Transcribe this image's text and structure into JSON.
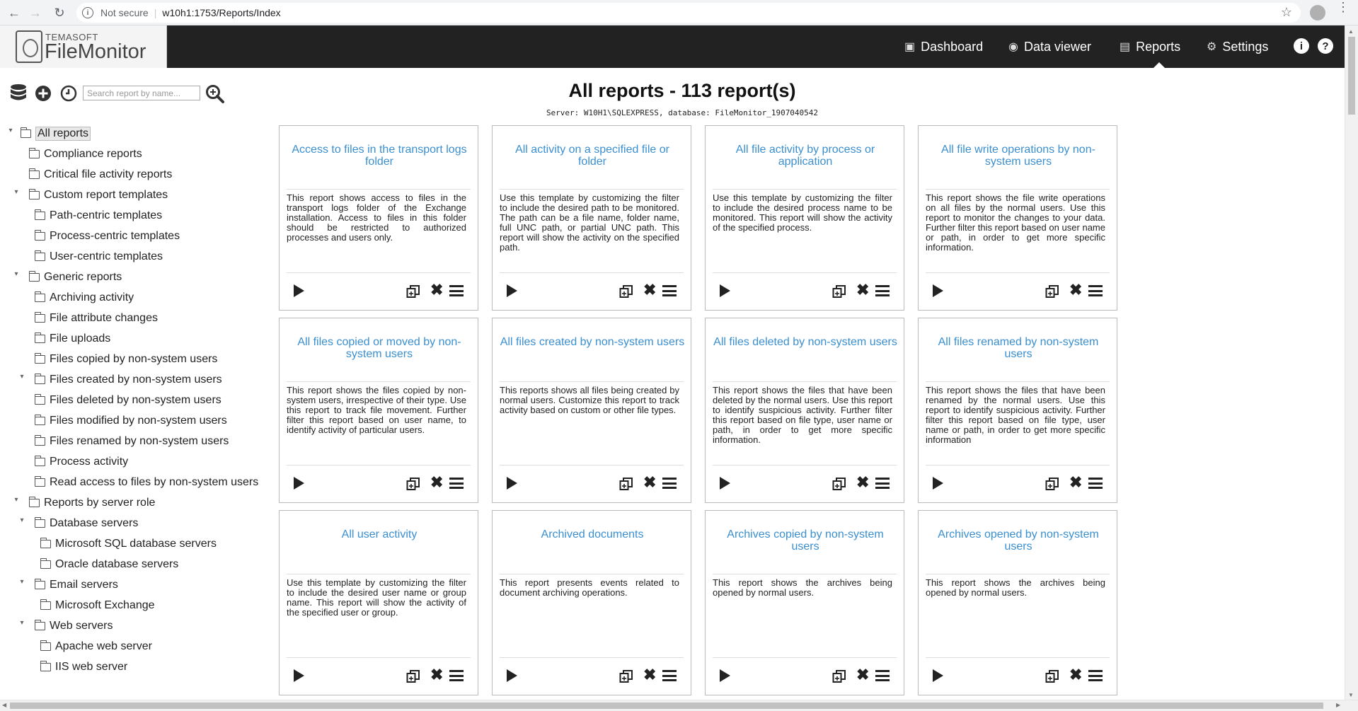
{
  "browser": {
    "security_label": "Not secure",
    "url": "w10h1:1753/Reports/Index"
  },
  "header": {
    "logo_top": "TEMASOFT",
    "logo_bottom": "FileMonitor",
    "nav": [
      {
        "label": "Dashboard",
        "icon": "dashboard-icon"
      },
      {
        "label": "Data viewer",
        "icon": "data-viewer-icon"
      },
      {
        "label": "Reports",
        "icon": "reports-icon",
        "active": true
      },
      {
        "label": "Settings",
        "icon": "gear-icon"
      }
    ],
    "info_glyph": "i",
    "help_glyph": "?"
  },
  "sidebar": {
    "search_placeholder": "Search report by name...",
    "tree": [
      {
        "label": "All reports"
      },
      {
        "label": "Compliance reports"
      },
      {
        "label": "Critical file activity reports"
      },
      {
        "label": "Custom report templates"
      },
      {
        "label": "Path-centric templates"
      },
      {
        "label": "Process-centric templates"
      },
      {
        "label": "User-centric templates"
      },
      {
        "label": "Generic reports"
      },
      {
        "label": "Archiving activity"
      },
      {
        "label": "File attribute changes"
      },
      {
        "label": "File uploads"
      },
      {
        "label": "Files copied by non-system users"
      },
      {
        "label": "Files created by non-system users"
      },
      {
        "label": "Files deleted by non-system users"
      },
      {
        "label": "Files modified by non-system users"
      },
      {
        "label": "Files renamed by non-system users"
      },
      {
        "label": "Process activity"
      },
      {
        "label": "Read access to files by non-system users"
      },
      {
        "label": "Reports by server role"
      },
      {
        "label": "Database servers"
      },
      {
        "label": "Microsoft SQL database servers"
      },
      {
        "label": "Oracle database servers"
      },
      {
        "label": "Email servers"
      },
      {
        "label": "Microsoft Exchange"
      },
      {
        "label": "Web servers"
      },
      {
        "label": "Apache web server"
      },
      {
        "label": "IIS web server"
      }
    ]
  },
  "main": {
    "title": "All reports - 113 report(s)",
    "server_line": "Server: W10H1\\SQLEXPRESS, database: FileMonitor_1907040542",
    "cards": [
      {
        "title": "Access to files in the transport logs folder",
        "desc": "This report shows access to files in the transport logs folder of the Exchange installation. Access to files in this folder should be restricted to authorized processes and users only."
      },
      {
        "title": "All activity on a specified file or folder",
        "desc": "Use this template by customizing the filter to include the desired path to be monitored. The path can be a file name, folder name, full UNC path, or partial UNC path. This report will show the activity on the specified path."
      },
      {
        "title": "All file activity by process or application",
        "desc": "Use this template by customizing the filter to include the desired process name to be monitored. This report will show the activity of the specified process."
      },
      {
        "title": "All file write operations by non-system users",
        "desc": "This report shows the file write operations on all files by the normal users. Use this report to monitor the changes to your data. Further filter this report based on user name or path, in order to get more specific information."
      },
      {
        "title": "All files copied or moved by non-system users",
        "desc": "This report shows the files copied by non-system users, irrespective of their type. Use this report to track file movement. Further filter this report based on user name, to identify activity of particular users."
      },
      {
        "title": "All files created by non-system users",
        "desc": "This reports shows all files being created by normal users. Customize this report to track activity based on custom or other file types."
      },
      {
        "title": "All files deleted by non-system users",
        "desc": "This report shows the files that have been deleted by the normal users. Use this report to identify suspicious activity. Further filter this report based on file type, user name or path, in order to get more specific information."
      },
      {
        "title": "All files renamed by non-system users",
        "desc": "This report shows the files that have been renamed by the normal users. Use this report to identify suspicious activity. Further filter this report based on file type, user name or path, in order to get more specific information"
      },
      {
        "title": "All user activity",
        "desc": "Use this template by customizing the filter to include the desired user name or group name. This report will show the activity of the specified user or group."
      },
      {
        "title": "Archived documents",
        "desc": "This report presents events related to document archiving operations."
      },
      {
        "title": "Archives copied by non-system users",
        "desc": "This report shows the archives being opened by normal users."
      },
      {
        "title": "Archives opened by non-system users",
        "desc": "This report shows the archives being opened by normal users."
      }
    ]
  }
}
